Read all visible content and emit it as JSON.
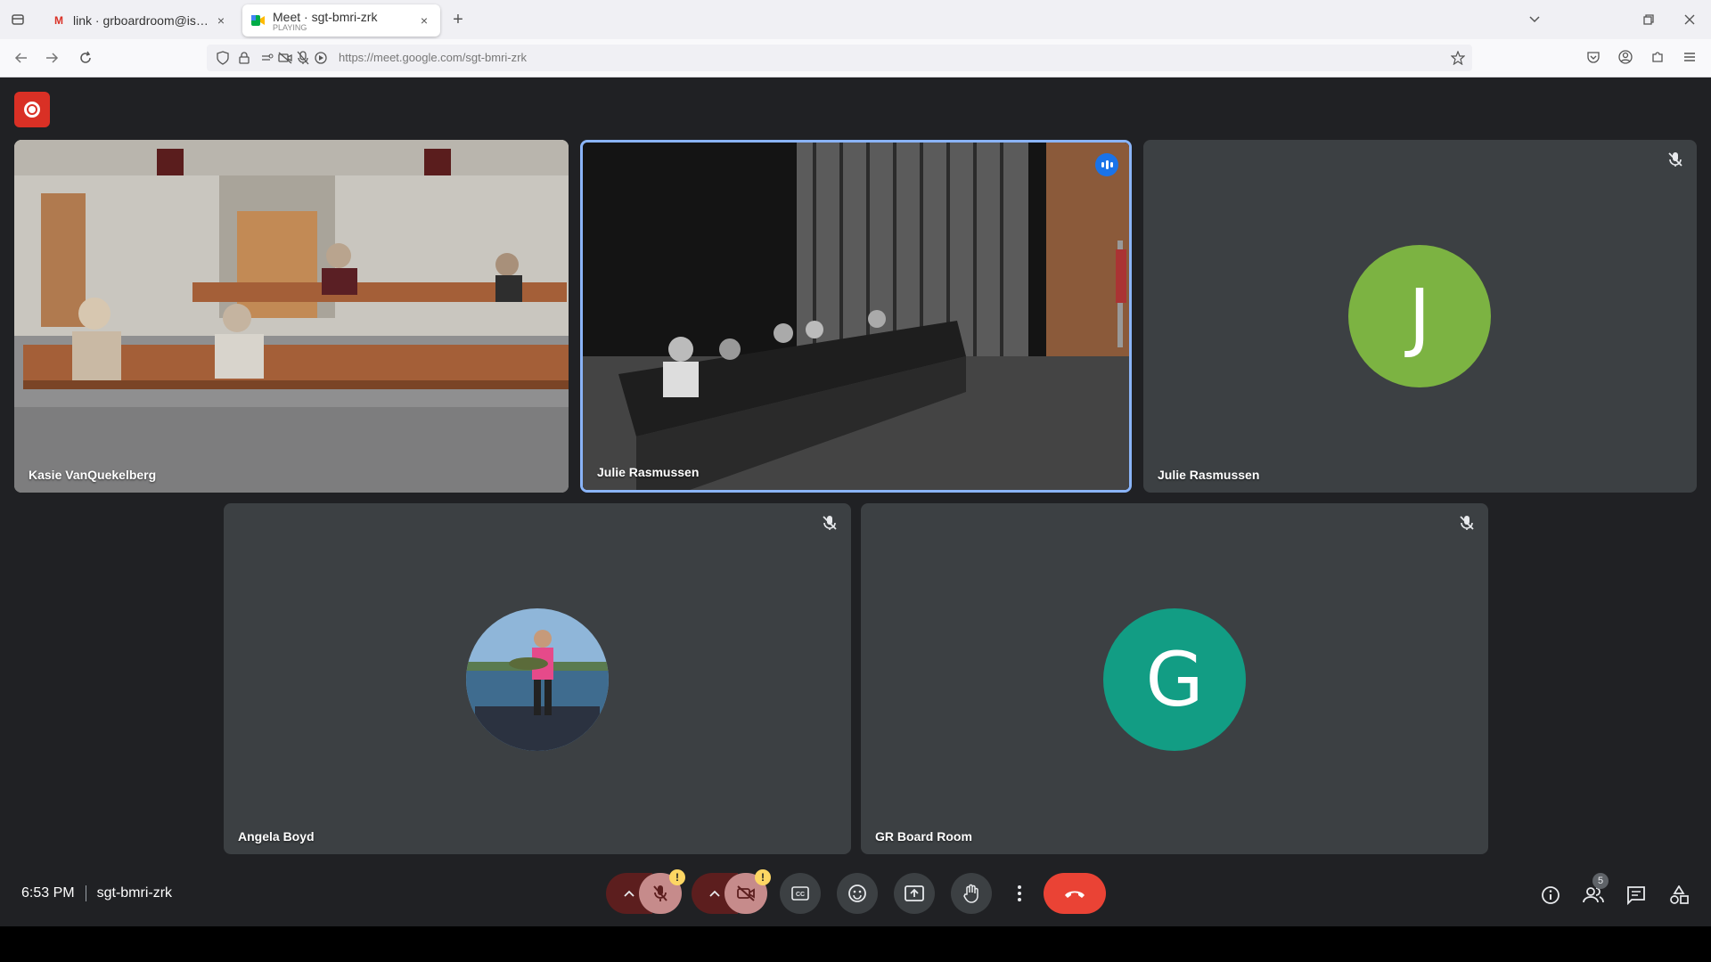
{
  "browser": {
    "tabs": [
      {
        "title": "link · grboardroom@isd318.org",
        "active": false
      },
      {
        "title": "Meet · sgt-bmri-zrk",
        "subtitle": "PLAYING",
        "active": true
      }
    ],
    "url": "https://meet.google.com/sgt-bmri-zrk"
  },
  "meet": {
    "participants": [
      {
        "name": "Kasie VanQuekelberg",
        "type": "video"
      },
      {
        "name": "Julie Rasmussen",
        "type": "video",
        "speaking": true
      },
      {
        "name": "Julie Rasmussen",
        "type": "avatar",
        "initial": "J",
        "color": "#7cb342",
        "muted": true
      },
      {
        "name": "Angela Boyd",
        "type": "photo",
        "muted": true
      },
      {
        "name": "GR Board Room",
        "type": "avatar",
        "initial": "G",
        "color": "#129d84",
        "muted": true
      }
    ],
    "time": "6:53 PM",
    "meeting_code": "sgt-bmri-zrk",
    "participant_count": "5",
    "warning_glyph": "!"
  },
  "colors": {
    "background": "#202124",
    "tile": "#3c4043",
    "accent": "#1a73e8",
    "end_call": "#ea4335",
    "record": "#d93025"
  }
}
